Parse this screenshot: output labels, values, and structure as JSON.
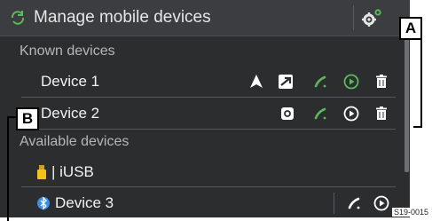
{
  "header": {
    "title": "Manage mobile devices"
  },
  "sections": {
    "known": "Known devices",
    "available": "Available devices"
  },
  "devices": {
    "device1": "Device 1",
    "device2": "Device 2",
    "usb": "| iUSB",
    "device3": "Device 3"
  },
  "callouts": {
    "a": "A",
    "b": "B"
  },
  "figure_code": "S19-0015",
  "colors": {
    "background": "#2b2d2f",
    "accent_green": "#5cb85c",
    "bluetooth_blue": "#3a8ee6",
    "text": "#f2f2f2"
  },
  "icons": [
    "refresh-icon",
    "settings-gear-icon",
    "android-auto-icon",
    "mirrorlink-icon",
    "phone-icon",
    "media-play-icon",
    "delete-icon",
    "carplay-icon",
    "usb-icon",
    "bluetooth-icon"
  ]
}
